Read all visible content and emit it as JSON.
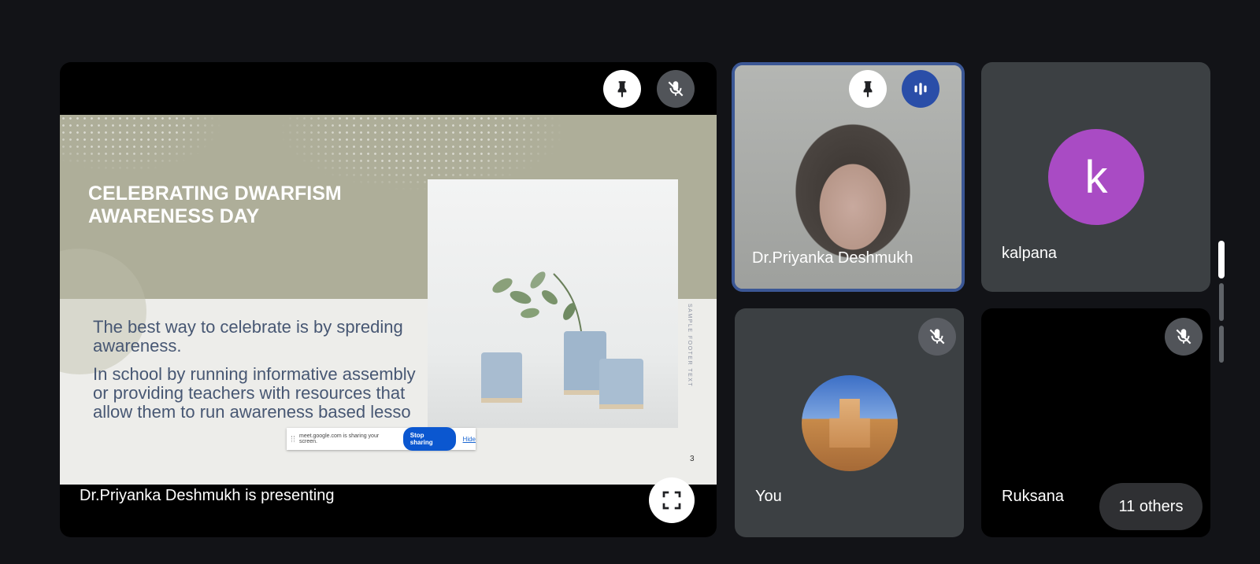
{
  "presentation": {
    "presenting_label": "Dr.Priyanka Deshmukh is presenting",
    "pin_icon": "pin-icon",
    "mic_off_icon": "mic-off-icon",
    "fullscreen_icon": "fullscreen-icon",
    "slide": {
      "title": "CELEBRATING DWARFISM AWARENESS DAY",
      "body_1": "The best way to celebrate is by spreding awareness.",
      "body_2": "In school by running informative assembly or providing teachers with resources that allow them to run awareness based lesso",
      "footer_vertical": "SAMPLE FOOTER TEXT",
      "page_number": "3"
    },
    "share_bar": {
      "message": "meet.google.com is sharing your screen.",
      "stop_label": "Stop sharing",
      "hide_label": "Hide"
    }
  },
  "participants": [
    {
      "name": "Dr.Priyanka Deshmukh",
      "speaking_icon": "audio-level-icon",
      "pin_icon": "pin-icon"
    },
    {
      "name": "kalpana",
      "avatar_letter": "k",
      "avatar_color": "#a94bc4"
    },
    {
      "name": "You",
      "mic_off_icon": "mic-off-icon"
    },
    {
      "name": "Ruksana",
      "mic_off_icon": "mic-off-icon"
    }
  ],
  "others_label": "11 others",
  "colors": {
    "background": "#121317",
    "tile": "#3c4043",
    "active_speaker_border": "#3b5795",
    "stop_button": "#0b57d0"
  }
}
